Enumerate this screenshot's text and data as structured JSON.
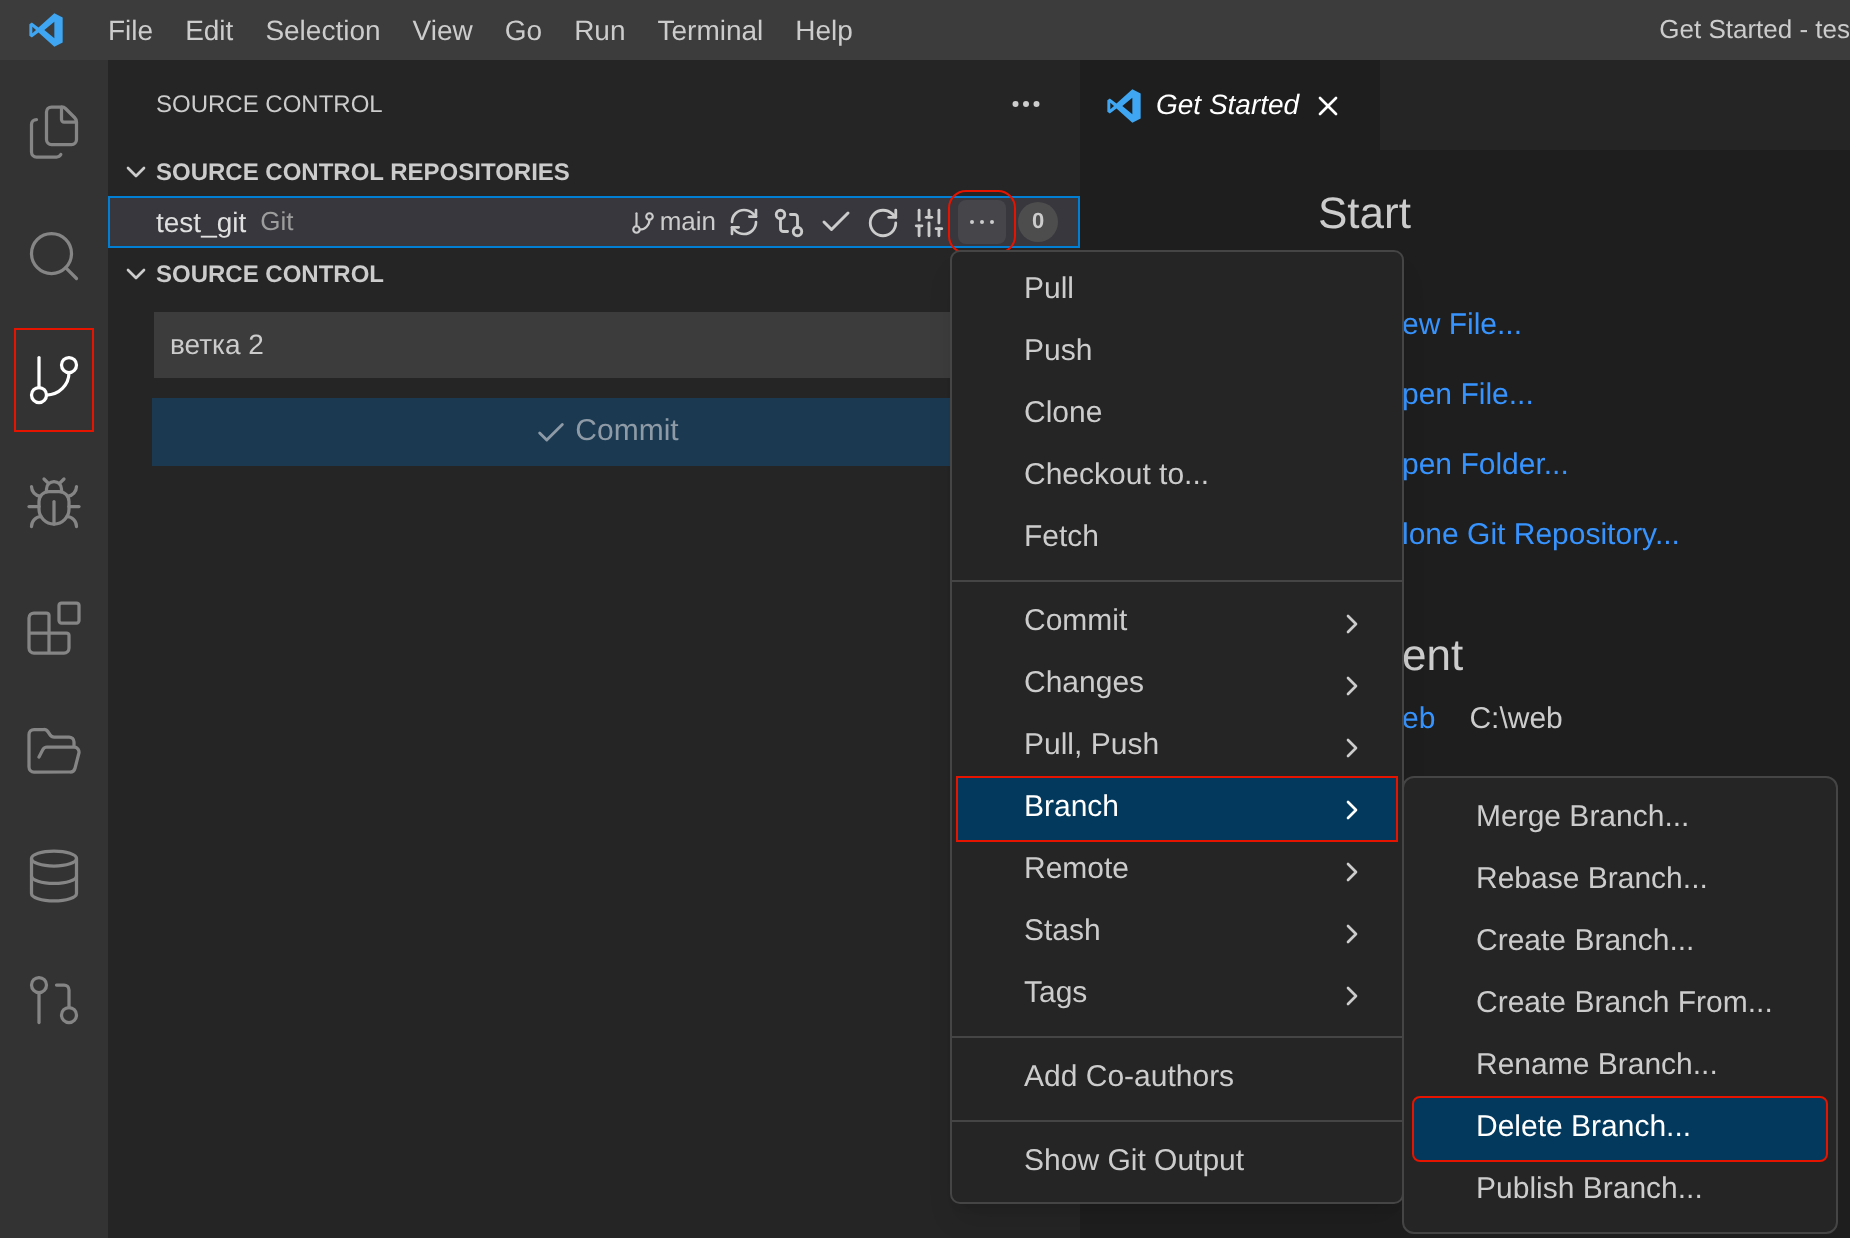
{
  "menu_bar": [
    "File",
    "Edit",
    "Selection",
    "View",
    "Go",
    "Run",
    "Terminal",
    "Help"
  ],
  "window_title": "Get Started - tes",
  "activity_bar": [
    {
      "kind": "files",
      "selected": false,
      "highlighted": false
    },
    {
      "kind": "search",
      "selected": false,
      "highlighted": false
    },
    {
      "kind": "scm",
      "selected": true,
      "highlighted": true
    },
    {
      "kind": "debug",
      "selected": false,
      "highlighted": false
    },
    {
      "kind": "extensions",
      "selected": false,
      "highlighted": false
    },
    {
      "kind": "folders",
      "selected": false,
      "highlighted": false
    },
    {
      "kind": "database",
      "selected": false,
      "highlighted": false
    },
    {
      "kind": "graph",
      "selected": false,
      "highlighted": false
    }
  ],
  "sidebar": {
    "title": "SOURCE CONTROL",
    "repositories_header": "SOURCE CONTROL REPOSITORIES",
    "repository": {
      "name": "test_git",
      "provider": "Git",
      "branch": "main",
      "more_highlighted": true,
      "count": "0"
    },
    "source_control_header": "SOURCE CONTROL",
    "message": "ветка 2",
    "commit_button": "Commit"
  },
  "editor": {
    "tab": {
      "title": "Get Started",
      "selected": true
    },
    "start_heading": "Start",
    "links": [
      "ew File...",
      "pen File...",
      "pen Folder...",
      "lone Git Repository..."
    ],
    "recent_heading": "ent",
    "recent": {
      "name": "eb",
      "path": "C:\\web"
    }
  },
  "context_menu": {
    "groups": [
      [
        {
          "label": "Pull",
          "submenu": false,
          "selected": false
        },
        {
          "label": "Push",
          "submenu": false,
          "selected": false
        },
        {
          "label": "Clone",
          "submenu": false,
          "selected": false
        },
        {
          "label": "Checkout to...",
          "submenu": false,
          "selected": false
        },
        {
          "label": "Fetch",
          "submenu": false,
          "selected": false
        }
      ],
      [
        {
          "label": "Commit",
          "submenu": true,
          "selected": false
        },
        {
          "label": "Changes",
          "submenu": true,
          "selected": false
        },
        {
          "label": "Pull, Push",
          "submenu": true,
          "selected": false
        },
        {
          "label": "Branch",
          "submenu": true,
          "selected": true
        },
        {
          "label": "Remote",
          "submenu": true,
          "selected": false
        },
        {
          "label": "Stash",
          "submenu": true,
          "selected": false
        },
        {
          "label": "Tags",
          "submenu": true,
          "selected": false
        }
      ],
      [
        {
          "label": "Add Co-authors",
          "submenu": false,
          "selected": false
        }
      ],
      [
        {
          "label": "Show Git Output",
          "submenu": false,
          "selected": false
        }
      ]
    ]
  },
  "branch_submenu": [
    {
      "label": "Merge Branch...",
      "selected": false
    },
    {
      "label": "Rebase Branch...",
      "selected": false
    },
    {
      "label": "Create Branch...",
      "selected": false
    },
    {
      "label": "Create Branch From...",
      "selected": false
    },
    {
      "label": "Rename Branch...",
      "selected": false
    },
    {
      "label": "Delete Branch...",
      "selected": true
    },
    {
      "label": "Publish Branch...",
      "selected": false
    }
  ]
}
